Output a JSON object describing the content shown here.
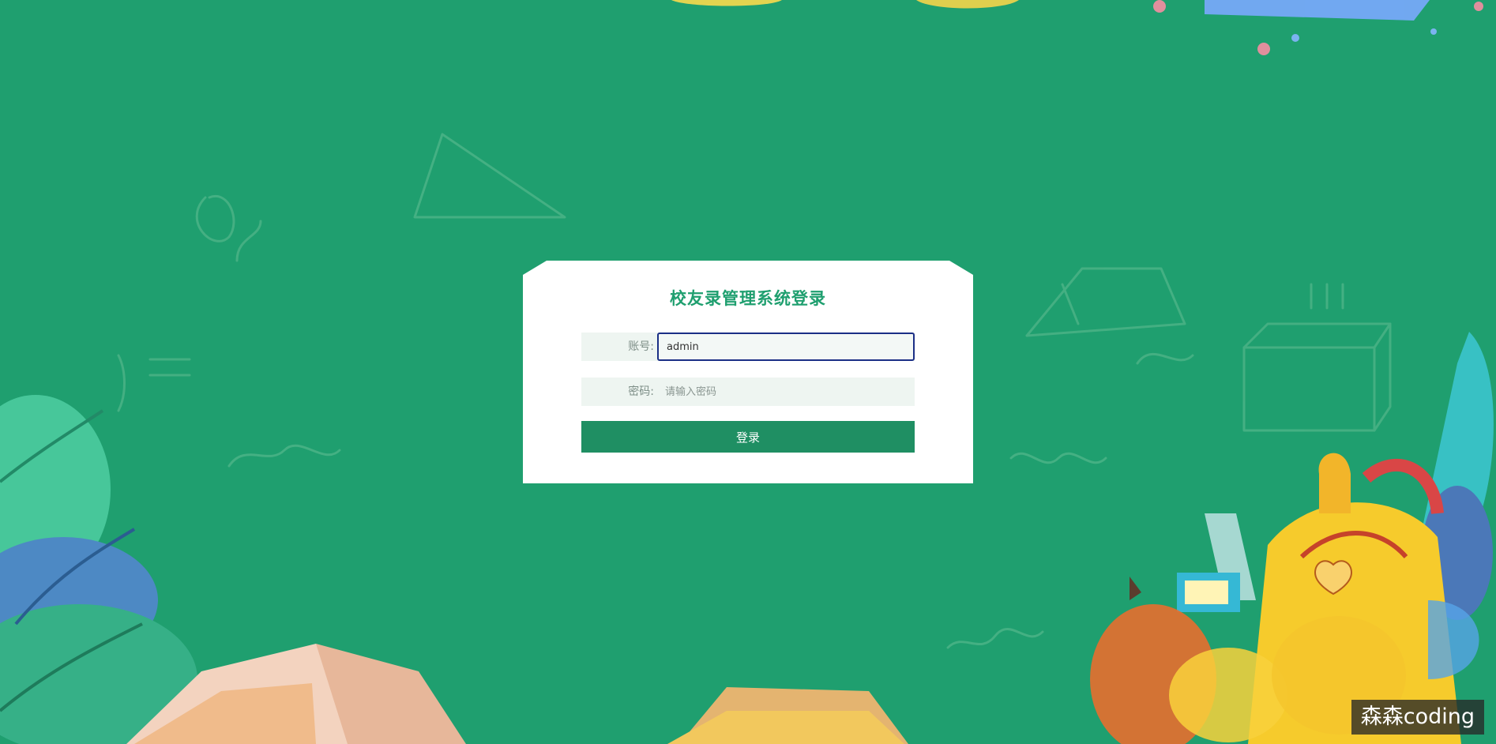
{
  "login": {
    "title": "校友录管理系统登录",
    "account_label": "账号:",
    "account_value": "admin",
    "password_label": "密码:",
    "password_placeholder": "请输入密码",
    "button_label": "登录"
  },
  "watermark": {
    "text": "森森coding"
  },
  "colors": {
    "background": "#1f9f6f",
    "title": "#1f9f6f",
    "button": "#1f8f63",
    "focus_border": "#1b2f86"
  }
}
